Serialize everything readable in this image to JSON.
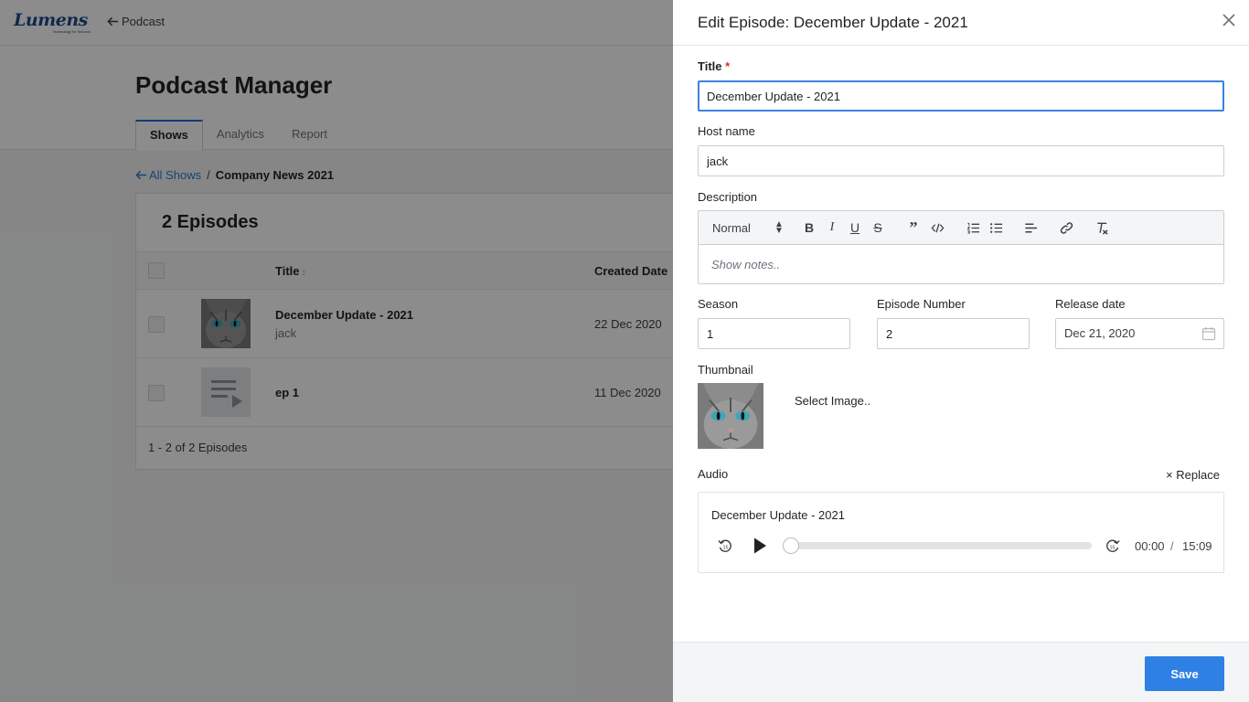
{
  "app": {
    "logo_text": "Lumens",
    "logo_tagline": "Technology for Schools",
    "back_label": "Podcast"
  },
  "page": {
    "title": "Podcast Manager",
    "tabs": [
      {
        "label": "Shows",
        "active": true
      },
      {
        "label": "Analytics",
        "active": false
      },
      {
        "label": "Report",
        "active": false
      }
    ],
    "breadcrumb": {
      "link": "All Shows",
      "separator": "/",
      "current": "Company News 2021"
    }
  },
  "episodes": {
    "heading": "2 Episodes",
    "columns": {
      "title": "Title",
      "title_sort": "↕",
      "created": "Created Date"
    },
    "rows": [
      {
        "title": "December Update - 2021",
        "host": "jack",
        "created": "22 Dec 2020",
        "thumbnail": "cat-photo"
      },
      {
        "title": "ep 1",
        "host": "",
        "created": "11 Dec 2020",
        "thumbnail": "playlist-icon"
      }
    ],
    "footer": "1 - 2 of 2 Episodes"
  },
  "drawer": {
    "title": "Edit Episode: December Update - 2021",
    "close_icon": "close-icon",
    "fields": {
      "title_label": "Title",
      "required_mark": "*",
      "title_value": "December Update - 2021",
      "host_label": "Host name",
      "host_value": "jack",
      "description_label": "Description",
      "description_format": "Normal",
      "description_placeholder": "Show notes..",
      "season_label": "Season",
      "season_value": "1",
      "episode_label": "Episode Number",
      "episode_value": "2",
      "release_label": "Release date",
      "release_value": "Dec 21, 2020",
      "thumbnail_label": "Thumbnail",
      "select_image": "Select Image..",
      "audio_label": "Audio",
      "replace_label": "× Replace"
    },
    "audio": {
      "track_title": "December Update - 2021",
      "current_time": "00:00",
      "separator": "/",
      "duration": "15:09",
      "progress": 0
    },
    "save_label": "Save"
  },
  "colors": {
    "accent": "#2f80e4",
    "focus_border": "#3c82e0",
    "link": "#2b7bd1",
    "required": "#d9322b",
    "overlay": "rgba(0,0,0,0.45)"
  }
}
